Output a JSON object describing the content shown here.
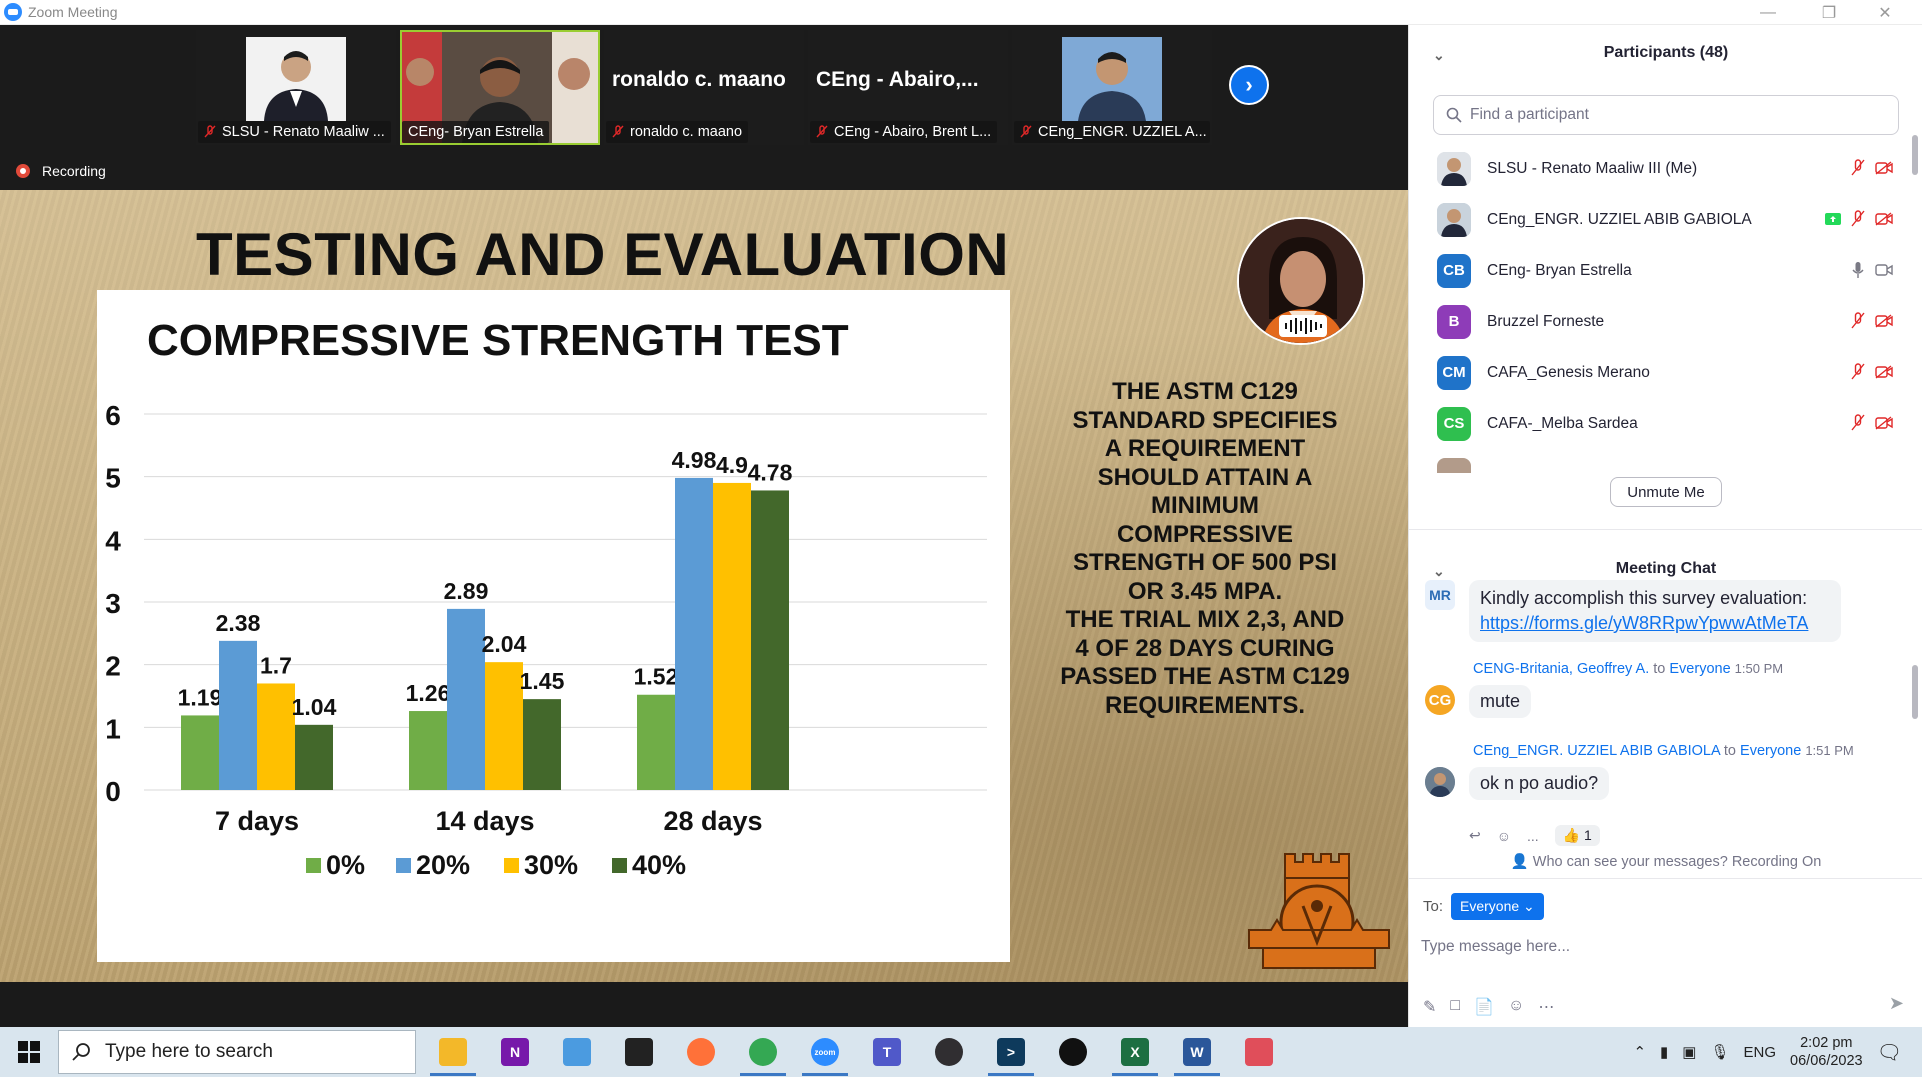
{
  "window": {
    "title": "Zoom Meeting"
  },
  "video_strip": {
    "thumbnails": [
      {
        "name": "SLSU - Renato Maaliw ...",
        "kind": "video"
      },
      {
        "name": "CEng- Bryan Estrella",
        "kind": "video",
        "active": true
      },
      {
        "name": "ronaldo c. maano",
        "big_name": "ronaldo c. maano",
        "kind": "name"
      },
      {
        "name": "CEng - Abairo, Brent L...",
        "big_name": "CEng - Abairo,...",
        "kind": "name"
      },
      {
        "name": "CEng_ENGR. UZZIEL A...",
        "kind": "video"
      }
    ],
    "recording_label": "Recording"
  },
  "slide": {
    "title": "TESTING AND EVALUATION",
    "note_lines": [
      "THE ASTM C129",
      "STANDARD SPECIFIES",
      "A REQUIREMENT",
      "SHOULD ATTAIN A",
      "MINIMUM",
      "COMPRESSIVE",
      "STRENGTH OF 500 PSI",
      "OR 3.45 MPA.",
      "THE TRIAL MIX 2,3, AND",
      "4 OF 28 DAYS CURING",
      "PASSED THE ASTM C129",
      "REQUIREMENTS."
    ]
  },
  "chart_data": {
    "type": "bar",
    "title": "COMPRESSIVE STRENGTH TEST",
    "categories": [
      "7 days",
      "14 days",
      "28 days"
    ],
    "series": [
      {
        "name": "0%",
        "values": [
          1.19,
          1.26,
          1.52
        ],
        "color": "#70ad47"
      },
      {
        "name": "20%",
        "values": [
          2.38,
          2.89,
          4.98
        ],
        "color": "#5b9bd5"
      },
      {
        "name": "30%",
        "values": [
          1.7,
          2.04,
          4.9
        ],
        "color": "#ffc000"
      },
      {
        "name": "40%",
        "values": [
          1.04,
          1.45,
          4.78
        ],
        "color": "#43682b"
      }
    ],
    "y_ticks": [
      "0",
      "1",
      "2",
      "3",
      "4",
      "5",
      "6"
    ],
    "ylim": [
      0,
      6
    ],
    "grid": true,
    "legend_position": "bottom"
  },
  "participants_panel": {
    "title": "Participants (48)",
    "search_placeholder": "Find a participant",
    "participants": [
      {
        "name": "SLSU - Renato Maaliw III (Me)",
        "avatar": "photo",
        "initials": "",
        "color": "#dfe3e8",
        "mic": "muted",
        "video": "off"
      },
      {
        "name": "CEng_ENGR. UZZIEL ABIB GABIOLA",
        "avatar": "photo",
        "initials": "",
        "color": "#c9d3dc",
        "mic": "muted",
        "video": "off",
        "sharing": true
      },
      {
        "name": "CEng- Bryan Estrella",
        "avatar": "initials",
        "initials": "CB",
        "color": "#1f73c9",
        "mic": "on",
        "video": "on"
      },
      {
        "name": "Bruzzel Forneste",
        "avatar": "initials",
        "initials": "B",
        "color": "#8e3cb8",
        "mic": "muted",
        "video": "off"
      },
      {
        "name": "CAFA_Genesis Merano",
        "avatar": "initials",
        "initials": "CM",
        "color": "#1f73c9",
        "mic": "muted",
        "video": "off"
      },
      {
        "name": "CAFA-_Melba Sardea",
        "avatar": "initials",
        "initials": "CS",
        "color": "#2fbf4f",
        "mic": "muted",
        "video": "off"
      }
    ],
    "unmute_label": "Unmute Me"
  },
  "chat": {
    "title": "Meeting Chat",
    "messages": [
      {
        "avatar": "MR",
        "avatar_color": "#4a90d9",
        "text": "Kindly accomplish this survey evaluation:",
        "link": "https://forms.gle/yW8RRpwYpwwAtMeTA"
      },
      {
        "avatar": "CG",
        "avatar_color": "#f5a623",
        "sender": "CENG-Britania, Geoffrey A.",
        "to": "to",
        "target": "Everyone",
        "time": "1:50 PM",
        "text": "mute"
      },
      {
        "avatar": "",
        "avatar_color": "#8a9aa8",
        "sender": "CEng_ENGR. UZZIEL ABIB GABIOLA",
        "to": "to",
        "target": "Everyone",
        "time": "1:51 PM",
        "text": "ok n po audio?"
      }
    ],
    "reaction": {
      "emoji": "👍",
      "count": "1"
    },
    "more": "...",
    "visibility_note": "Who can see your messages? Recording On",
    "to_label": "To:",
    "recipient": "Everyone",
    "input_placeholder": "Type message here..."
  },
  "taskbar": {
    "search_placeholder": "Type here to search",
    "apps": [
      {
        "name": "file-explorer",
        "label": "",
        "color": "#f3b829"
      },
      {
        "name": "onenote",
        "label": "N",
        "color": "#7719aa"
      },
      {
        "name": "paint",
        "label": "",
        "color": "#4b9be0"
      },
      {
        "name": "terminal",
        "label": "",
        "color": "#222222"
      },
      {
        "name": "firefox",
        "label": "",
        "color": "#ff7139"
      },
      {
        "name": "chrome",
        "label": "",
        "color": "#34a853"
      },
      {
        "name": "zoom",
        "label": "zoom",
        "color": "#2d8cff"
      },
      {
        "name": "teams",
        "label": "T",
        "color": "#5059c9"
      },
      {
        "name": "obs",
        "label": "",
        "color": "#302e31"
      },
      {
        "name": "powershell",
        "label": ">",
        "color": "#0e3a5c"
      },
      {
        "name": "github",
        "label": "",
        "color": "#111111"
      },
      {
        "name": "excel",
        "label": "X",
        "color": "#1d6f42"
      },
      {
        "name": "word",
        "label": "W",
        "color": "#2b579a"
      },
      {
        "name": "snipping",
        "label": "",
        "color": "#e04e5a"
      }
    ],
    "language": "ENG",
    "time": "2:02 pm",
    "date": "06/06/2023"
  }
}
